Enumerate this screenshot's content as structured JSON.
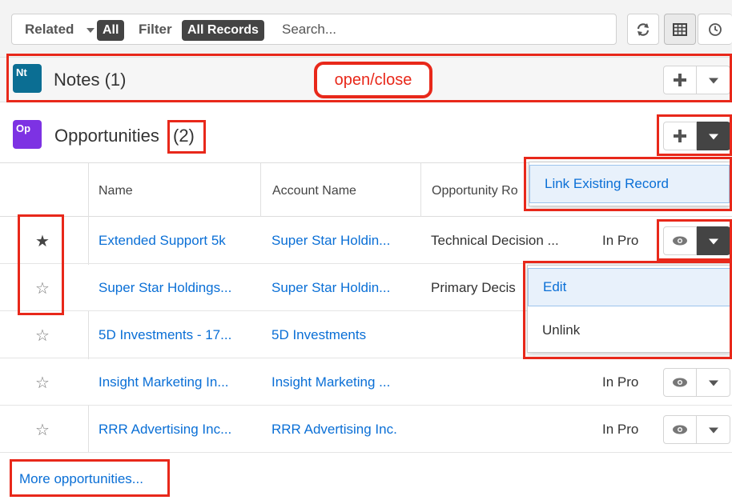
{
  "toolbar": {
    "related_label": "Related",
    "related_value": "All",
    "filter_label": "Filter",
    "filter_value": "All Records",
    "search_placeholder": "Search..."
  },
  "notes": {
    "badge": "Nt",
    "title": "Notes (1)",
    "annotation": "open/close"
  },
  "opportunities": {
    "badge": "Op",
    "title": "Opportunities",
    "count": "(2)",
    "columns": [
      "Name",
      "Account Name",
      "Opportunity Ro"
    ],
    "rows": [
      {
        "starred": true,
        "name": "Extended Support 5k",
        "account": "Super Star Holdin...",
        "role": "Technical Decision ...",
        "status": "In Pro"
      },
      {
        "starred": false,
        "name": "Super Star Holdings...",
        "account": "Super Star Holdin...",
        "role": "Primary Decis",
        "status": ""
      },
      {
        "starred": false,
        "name": "5D Investments - 17...",
        "account": "5D Investments",
        "role": "",
        "status": ""
      },
      {
        "starred": false,
        "name": "Insight Marketing In...",
        "account": "Insight Marketing ...",
        "role": "",
        "status": "In Pro"
      },
      {
        "starred": false,
        "name": "RRR Advertising Inc...",
        "account": "RRR Advertising Inc.",
        "role": "",
        "status": "In Pro"
      }
    ],
    "more_link": "More opportunities..."
  },
  "create_menu": {
    "items": [
      "Link Existing Record"
    ]
  },
  "row_menu": {
    "items": [
      "Edit",
      "Unlink"
    ]
  },
  "colors": {
    "link": "#0a6fd6",
    "highlight": "#e8281a",
    "notes_badge": "#0b6e93",
    "opps_badge": "#7d32e3"
  }
}
